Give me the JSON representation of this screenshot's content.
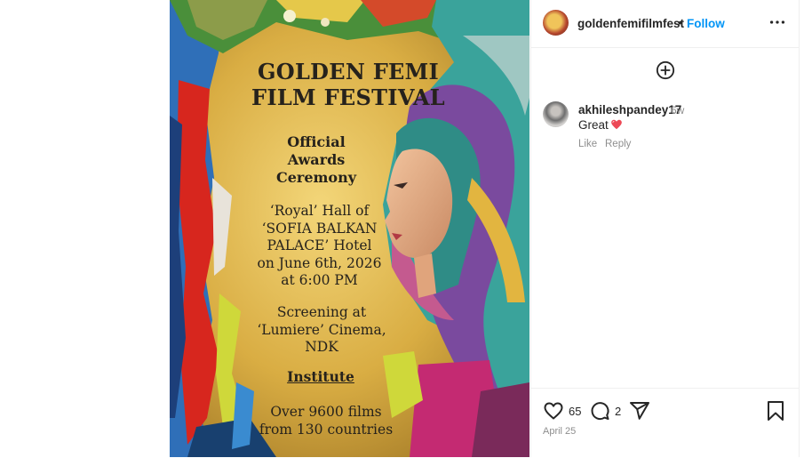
{
  "poster": {
    "title_line1": "GOLDEN FEMI",
    "title_line2": "FILM FESTIVAL",
    "sub_line1": "Official",
    "sub_line2": "Awards",
    "sub_line3": "Ceremony",
    "venue_line1": "‘Royal’ Hall of",
    "venue_line2": "‘SOFIA BALKAN",
    "venue_line3": "PALACE’ Hotel",
    "venue_line4": "on June 6th, 2026",
    "venue_line5": "at 6:00 PM",
    "screen_line1": "Screening at",
    "screen_line2": "‘Lumiere’ Cinema,",
    "screen_line3": "NDK",
    "institute": "Institute",
    "films_line1": "Over 9600 films",
    "films_line2": "from 130 countries"
  },
  "header": {
    "username": "goldenfemifilmfest",
    "separator": "•",
    "follow_label": "Follow",
    "more_icon": "more-horizontal-icon"
  },
  "comment": {
    "username": "akhileshpandey17",
    "time": "6w",
    "text": "Great",
    "emoji": "heart-emoji",
    "like_label": "Like",
    "reply_label": "Reply"
  },
  "actions": {
    "likes_count": "65",
    "comments_count": "2",
    "date": "April 25"
  },
  "colors": {
    "accent": "#0095f6",
    "muted": "#8e8e8e",
    "text": "#262626",
    "heart": "#ed4956"
  }
}
